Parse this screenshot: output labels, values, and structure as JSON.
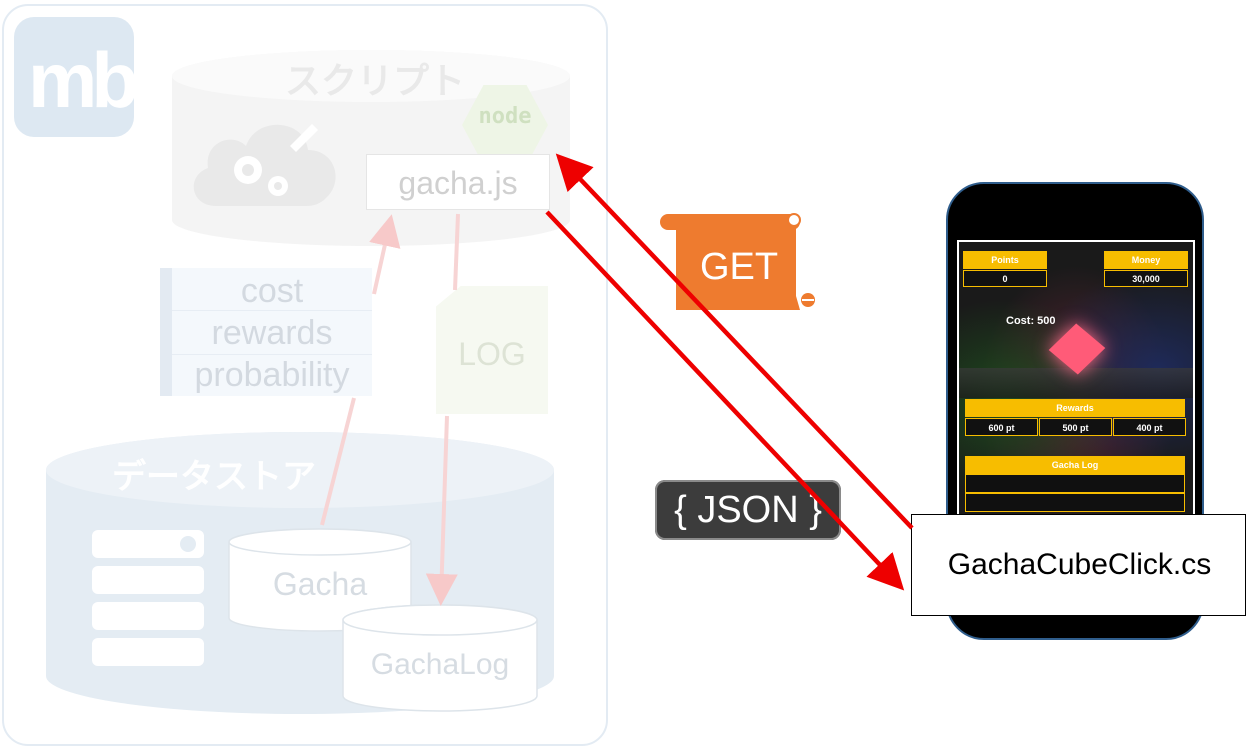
{
  "logo": {
    "text": "mb"
  },
  "script_section": {
    "title": "スクリプト",
    "node_badge": "node",
    "file": "gacha.js"
  },
  "parameters": [
    "cost",
    "rewards",
    "probability"
  ],
  "log_doc": "LOG",
  "datastore": {
    "title": "データストア",
    "tables": [
      "Gacha",
      "GachaLog"
    ]
  },
  "request": {
    "method": "GET"
  },
  "response": {
    "format": "{ JSON }"
  },
  "phone_app": {
    "points_label": "Points",
    "points_value": "0",
    "money_label": "Money",
    "money_value": "30,000",
    "cost_text": "Cost: 500",
    "rewards_label": "Rewards",
    "rewards": [
      "600 pt",
      "500 pt",
      "400 pt"
    ],
    "gacha_log_label": "Gacha Log",
    "script_file": "GachaCubeClick.cs"
  },
  "colors": {
    "arrow": "#ee0000",
    "get_scroll": "#ee7b2f",
    "hud_accent": "#f7bd00",
    "phone_border": "#2f5d8c"
  }
}
